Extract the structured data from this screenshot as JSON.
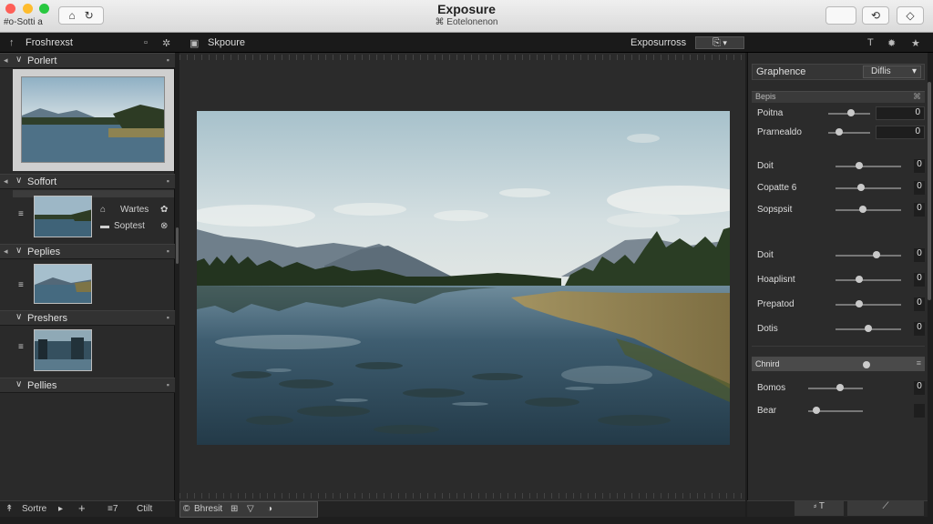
{
  "window": {
    "title": "Exposure",
    "subtitle": "⌘ Eotelonenon",
    "app_label": "#o-Sotti a"
  },
  "titlebar": {
    "left_buttons": [
      "⌂",
      "↻"
    ],
    "right_buttons": [
      "",
      "⟲",
      "◇"
    ]
  },
  "strip": {
    "left_label": "Froshrexst",
    "center_label": "Skpoure",
    "mode_label": "Exposurross",
    "mode_icon": "⎘"
  },
  "left_panel": {
    "sections": [
      {
        "label": "Porlert"
      },
      {
        "label": "Soffort"
      },
      {
        "label": "Peplies"
      },
      {
        "label": "Preshers"
      },
      {
        "label": "Pellies"
      }
    ],
    "items": [
      {
        "label": "Wartes"
      },
      {
        "label": "Soptest"
      }
    ],
    "bottom": {
      "label": "Sortre",
      "plus": "+",
      "count_label": "≡7",
      "edit_label": "Ctilt"
    }
  },
  "canvas": {
    "bottom_label": "Bhresit"
  },
  "right_panel": {
    "header": "Graphence",
    "dropdown": "Diflis",
    "section1": "Bepis",
    "rows1": [
      {
        "label": "Poitna",
        "value": "0",
        "level": 0.55
      },
      {
        "label": "Prarnealdo",
        "value": "0",
        "level": 0.2
      }
    ],
    "rows2": [
      {
        "label": "Doit",
        "value": "0",
        "level": 0.35
      },
      {
        "label": "Copatte 6",
        "value": "0",
        "level": 0.38
      },
      {
        "label": "Sopspsit",
        "value": "0",
        "level": 0.4
      }
    ],
    "rows3": [
      {
        "label": "Doit",
        "value": "0",
        "level": 0.64
      },
      {
        "label": "Hoaplisnt",
        "value": "0",
        "level": 0.34
      },
      {
        "label": "Prepatod",
        "value": "0",
        "level": 0.34
      },
      {
        "label": "Dotis",
        "value": "0",
        "level": 0.5
      }
    ],
    "section2": "Chnird",
    "rows4": [
      {
        "label": "Bomos",
        "value": "0",
        "level": 0.6
      },
      {
        "label": "Bear",
        "value": "",
        "level": 0.1
      }
    ],
    "bottom": {
      "left": "⸗ T",
      "right": "⟋"
    }
  },
  "colors": {
    "sky_top": "#a7c1cb",
    "water": "#3e5d70",
    "grass": "#8a7a4c",
    "forest": "#23341f"
  }
}
